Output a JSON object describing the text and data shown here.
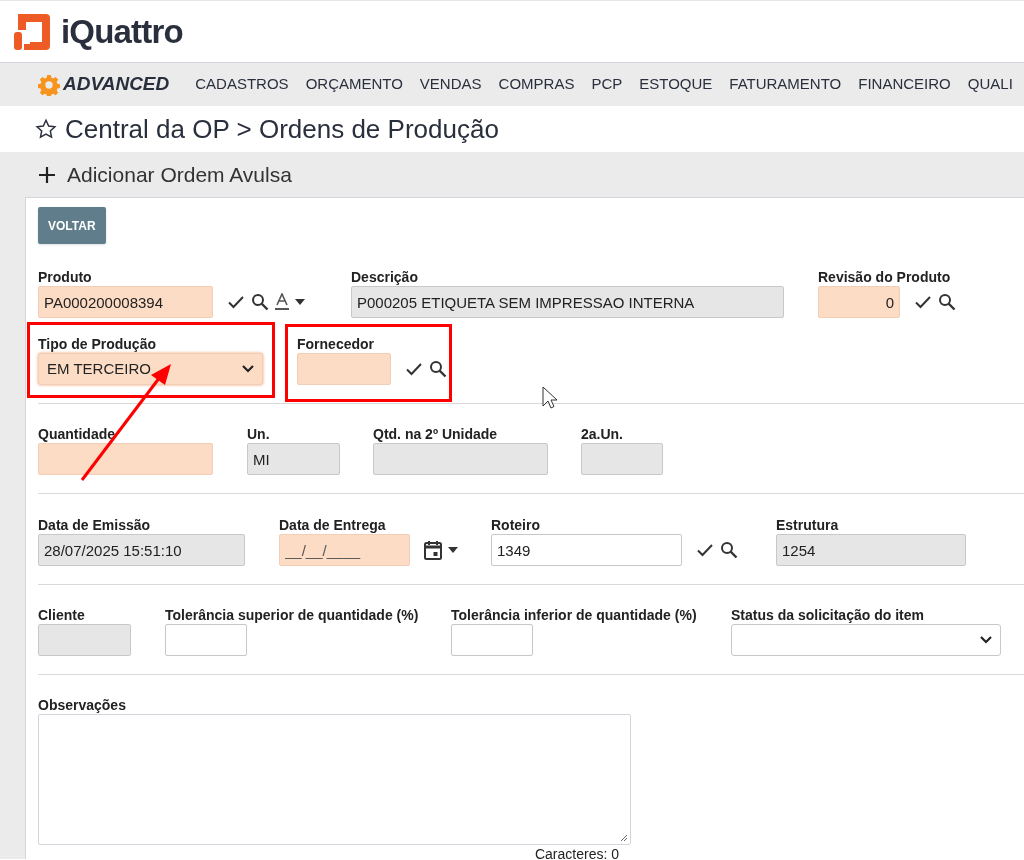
{
  "header": {
    "logo_text": "iQuattro"
  },
  "nav": {
    "brand": "ADVANCED",
    "items": [
      "CADASTROS",
      "ORÇAMENTO",
      "VENDAS",
      "COMPRAS",
      "PCP",
      "ESTOQUE",
      "FATURAMENTO",
      "FINANCEIRO",
      "QUALI"
    ]
  },
  "page_title": "Central da OP > Ordens de Produção",
  "action": {
    "label": "Adicionar Ordem Avulsa"
  },
  "form": {
    "back_button": "VOLTAR",
    "rows": [
      [
        {
          "label": "Produto",
          "kind": "text",
          "required": true,
          "readonly": false,
          "value": "PA000200008394"
        },
        {
          "label": "Descrição",
          "kind": "text",
          "required": false,
          "readonly": true,
          "value": "P000205 ETIQUETA SEM IMPRESSAO INTERNA"
        },
        {
          "label": "Revisão do Produto",
          "kind": "text",
          "required": true,
          "readonly": false,
          "value": "0"
        }
      ],
      [
        {
          "label": "Tipo de Produção",
          "kind": "select",
          "required": true,
          "readonly": false,
          "value": "EM TERCEIRO"
        },
        {
          "label": "Fornecedor",
          "kind": "text",
          "required": true,
          "readonly": false
        }
      ],
      [
        {
          "label": "Quantidade",
          "kind": "text",
          "required": true,
          "readonly": false
        },
        {
          "label": "Un.",
          "kind": "text",
          "required": false,
          "readonly": true,
          "value": "MI"
        },
        {
          "label": "Qtd. na 2º Unidade",
          "kind": "text",
          "required": false,
          "readonly": true
        },
        {
          "label": "2a.Un.",
          "kind": "text",
          "required": false,
          "readonly": true
        }
      ],
      [
        {
          "label": "Data de Emissão",
          "kind": "text",
          "required": false,
          "readonly": true,
          "value": "28/07/2025 15:51:10"
        },
        {
          "label": "Data de Entrega",
          "kind": "date",
          "required": true,
          "readonly": false,
          "placeholder": "__/__/____"
        },
        {
          "label": "Roteiro",
          "kind": "text",
          "required": false,
          "readonly": false,
          "value": "1349"
        },
        {
          "label": "Estrutura",
          "kind": "text",
          "required": false,
          "readonly": true,
          "value": "1254"
        }
      ],
      [
        {
          "label": "Cliente",
          "kind": "text",
          "required": false,
          "readonly": true
        },
        {
          "label": "Tolerância superior de quantidade (%)",
          "kind": "text",
          "required": false,
          "readonly": false
        },
        {
          "label": "Tolerância inferior de quantidade (%)",
          "kind": "text",
          "required": false,
          "readonly": false
        },
        {
          "label": "Status da solicitação do item",
          "kind": "select",
          "required": false,
          "readonly": false
        }
      ]
    ],
    "notes": {
      "label": "Observações",
      "counter": "Caracteres: 0"
    }
  }
}
